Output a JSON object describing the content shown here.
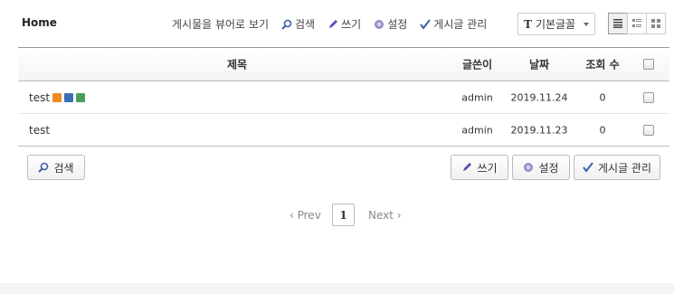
{
  "header": {
    "home": "Home",
    "view_board": "게시물을 뷰어로 보기",
    "search": "검색",
    "write": "쓰기",
    "settings": "설정",
    "manage": "게시글 관리",
    "font_select": "기본글꼴",
    "font_prefix": "T"
  },
  "table": {
    "columns": {
      "title": "제목",
      "author": "글쓴이",
      "date": "날짜",
      "views": "조회 수"
    },
    "rows": [
      {
        "title": "test",
        "author": "admin",
        "date": "2019.11.24",
        "views": "0"
      },
      {
        "title": "test",
        "author": "admin",
        "date": "2019.11.23",
        "views": "0"
      }
    ]
  },
  "actions": {
    "search": "검색",
    "write": "쓰기",
    "settings": "설정",
    "manage": "게시글 관리"
  },
  "pagination": {
    "prev": "‹ Prev",
    "current": "1",
    "next": "Next ›"
  },
  "colors": {
    "new_badge": "#f08a24",
    "save_icon": "#3a6fb8",
    "image_icon": "#4a9e5c",
    "search_icon": "#3b5fa8",
    "write_icon": "#5a4fb5",
    "settings_icon": "#9a86c8"
  }
}
